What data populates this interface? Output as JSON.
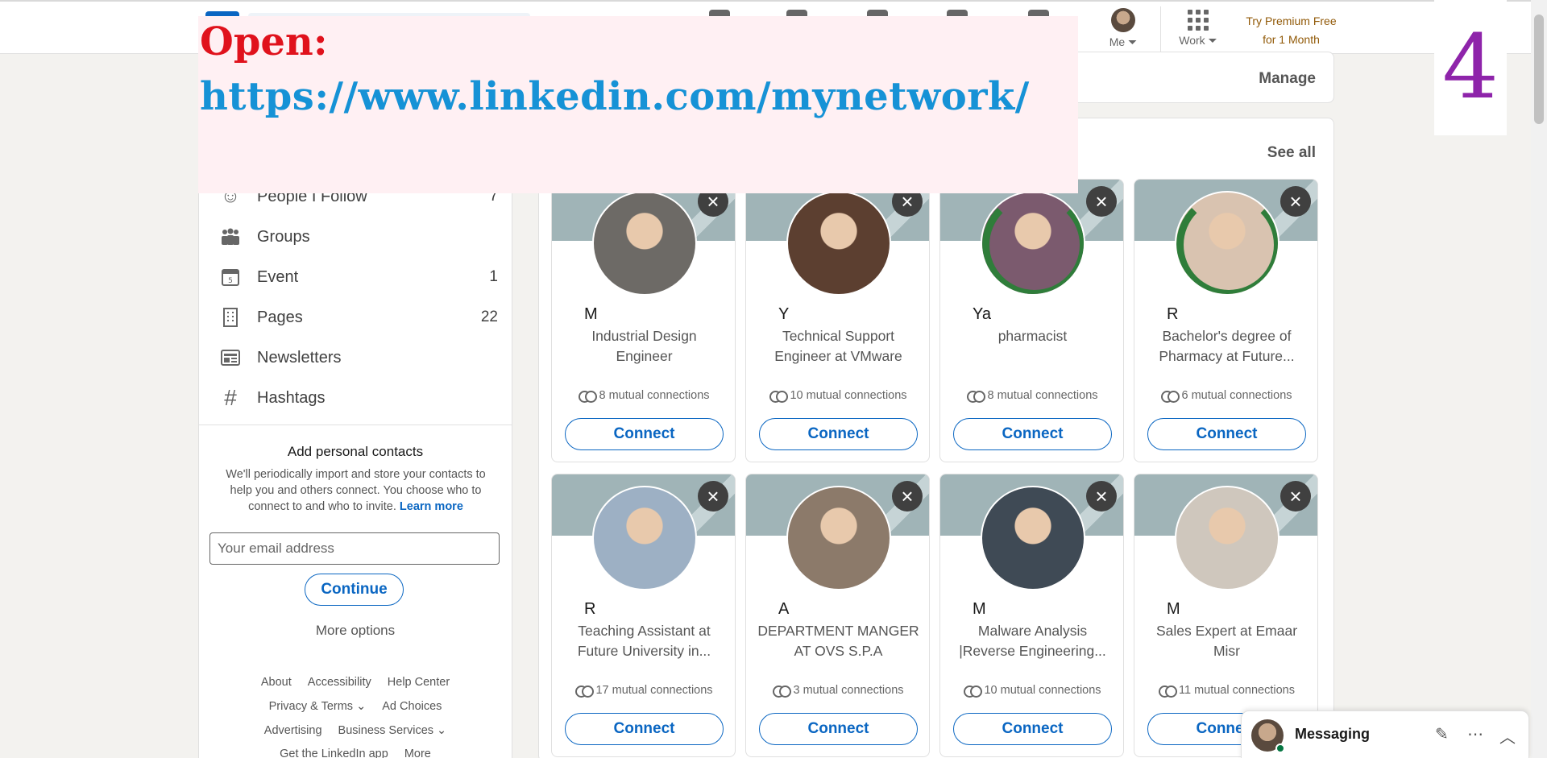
{
  "nav": {
    "me_label": "Me ⏷",
    "work_label": "Work ⏷",
    "premium_line1": "Try Premium Free",
    "premium_line2": "for 1 Month"
  },
  "overlay": {
    "open_label": "Open:",
    "url": "https://www.linkedin.com/mynetwork/",
    "step_number": "4"
  },
  "sidebar": {
    "items": [
      {
        "label": "People I Follow",
        "count": "7",
        "icon": "people-follow-icon"
      },
      {
        "label": "Groups",
        "count": "",
        "icon": "groups-icon"
      },
      {
        "label": "Event",
        "count": "1",
        "icon": "calendar-icon"
      },
      {
        "label": "Pages",
        "count": "22",
        "icon": "building-icon"
      },
      {
        "label": "Newsletters",
        "count": "",
        "icon": "newsletter-icon"
      },
      {
        "label": "Hashtags",
        "count": "",
        "icon": "hashtag-icon"
      }
    ],
    "contacts": {
      "title": "Add personal contacts",
      "description": "We'll periodically import and store your contacts to help you and others connect. You choose who to connect to and who to invite.",
      "learn_more": "Learn more",
      "email_placeholder": "Your email address",
      "continue_label": "Continue",
      "more_options": "More options"
    },
    "footer": {
      "row1": [
        "About",
        "Accessibility",
        "Help Center"
      ],
      "row2": [
        "Privacy & Terms ⌄",
        "Ad Choices"
      ],
      "row3": [
        "Advertising",
        "Business Services ⌄"
      ],
      "row4": [
        "Get the LinkedIn app",
        "More"
      ]
    }
  },
  "main": {
    "manage_label": "Manage",
    "see_all_label": "See all",
    "connect_label": "Connect",
    "people": [
      {
        "initial": "M",
        "headline": "Industrial Design Engineer",
        "mutual": "8 mutual connections",
        "open_to_work": false,
        "avatar": "#6d6a66"
      },
      {
        "initial": "Y",
        "headline": "Technical Support Engineer at VMware",
        "mutual": "10 mutual connections",
        "open_to_work": false,
        "avatar": "#5c3f30"
      },
      {
        "initial": "Ya",
        "headline": "pharmacist",
        "mutual": "8 mutual connections",
        "open_to_work": true,
        "avatar": "#7b5a6e"
      },
      {
        "initial": "R",
        "headline": "Bachelor's degree of Pharmacy at Future...",
        "mutual": "6 mutual connections",
        "open_to_work": true,
        "avatar": "#d9c3b0"
      },
      {
        "initial": "R",
        "headline": "Teaching Assistant at Future University in...",
        "mutual": "17 mutual connections",
        "open_to_work": false,
        "avatar": "#9db0c4"
      },
      {
        "initial": "A",
        "headline": "DEPARTMENT MANGER AT OVS S.P.A",
        "mutual": "3 mutual connections",
        "open_to_work": false,
        "avatar": "#8c7a6a"
      },
      {
        "initial": "M",
        "headline": "Malware Analysis |Reverse Engineering...",
        "mutual": "10 mutual connections",
        "open_to_work": false,
        "avatar": "#3f4a55"
      },
      {
        "initial": "M",
        "headline": "Sales Expert at Emaar Misr",
        "mutual": "11 mutual connections",
        "open_to_work": false,
        "avatar": "#cfc7bd"
      }
    ]
  },
  "messaging": {
    "label": "Messaging"
  }
}
